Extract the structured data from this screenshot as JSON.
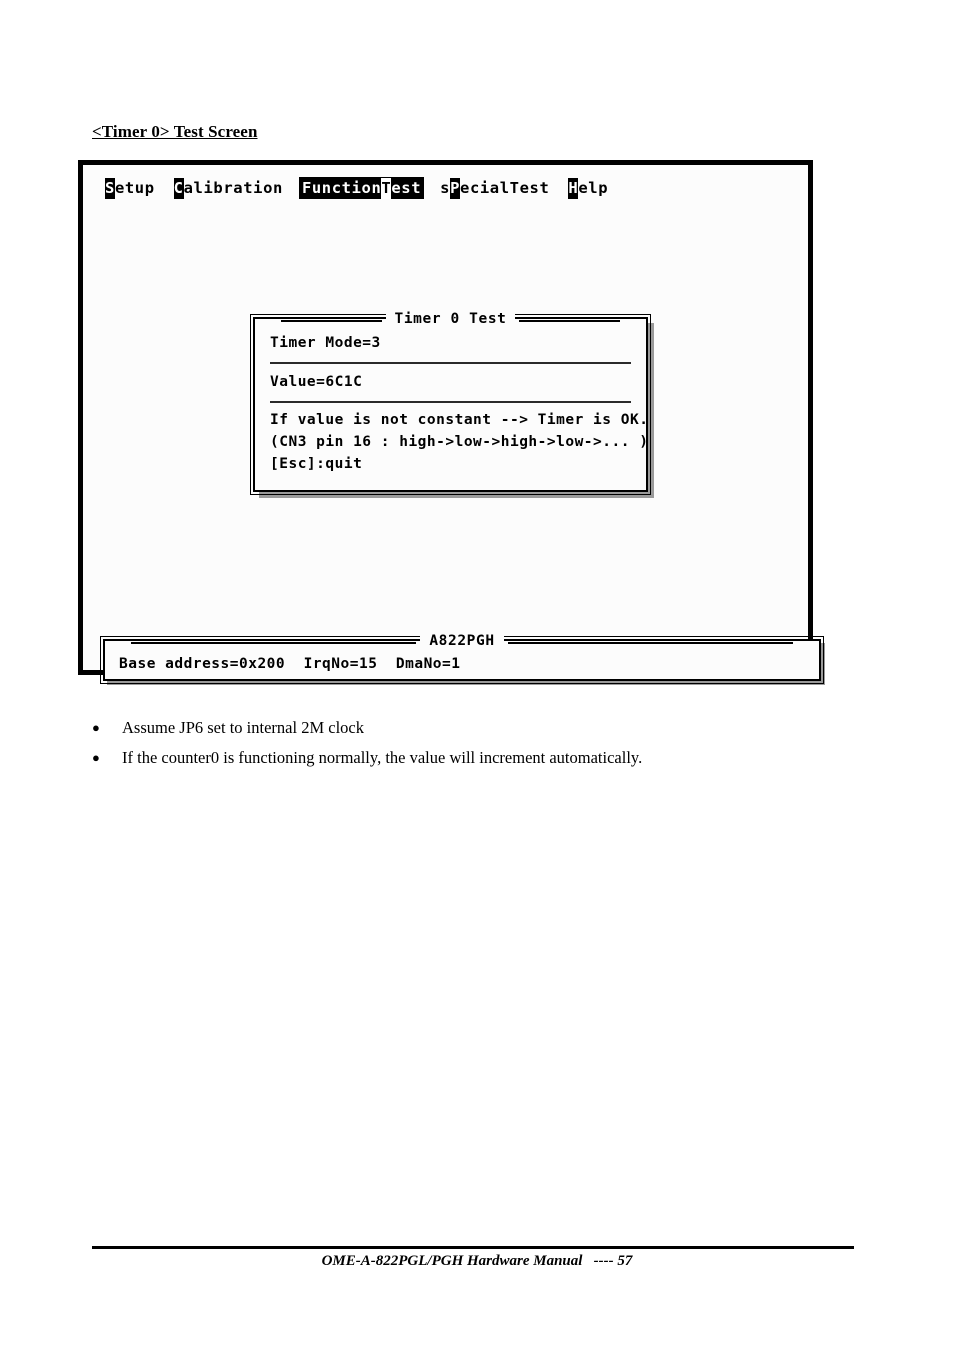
{
  "page": {
    "heading": "<Timer 0> Test Screen",
    "footer_text": "OME-A-822PGL/PGH Hardware Manual   ---- 57"
  },
  "dos_screen": {
    "background_color": "#fcfcfc",
    "border_color": "#000000",
    "menu": {
      "items": [
        {
          "before": "",
          "hotkey": "S",
          "after": "etup",
          "selected": false,
          "name": "setup"
        },
        {
          "before": "",
          "hotkey": "C",
          "after": "alibration",
          "selected": false,
          "name": "calibration"
        },
        {
          "before": "Function",
          "hotkey": "T",
          "after": "est",
          "selected": true,
          "name": "function-test"
        },
        {
          "before": "s",
          "hotkey": "P",
          "after": "ecialTest",
          "selected": false,
          "name": "special-test"
        },
        {
          "before": "",
          "hotkey": "H",
          "after": "elp",
          "selected": false,
          "name": "help"
        }
      ]
    },
    "dialog": {
      "title": "Timer 0 Test",
      "mode_line": "Timer Mode=3",
      "value_line": "Value=6C1C",
      "info_lines": [
        "If value is not constant --> Timer is OK.",
        "(CN3 pin 16 : high->low->high->low->... )",
        "[Esc]:quit"
      ]
    },
    "status_panel": {
      "title": "A822PGH",
      "text": "Base address=0x200  IrqNo=15  DmaNo=1"
    }
  },
  "notes": {
    "bullet_glyph": "●",
    "items": [
      "Assume JP6 set to internal 2M clock",
      "If the counter0 is functioning normally, the value will increment automatically."
    ]
  }
}
